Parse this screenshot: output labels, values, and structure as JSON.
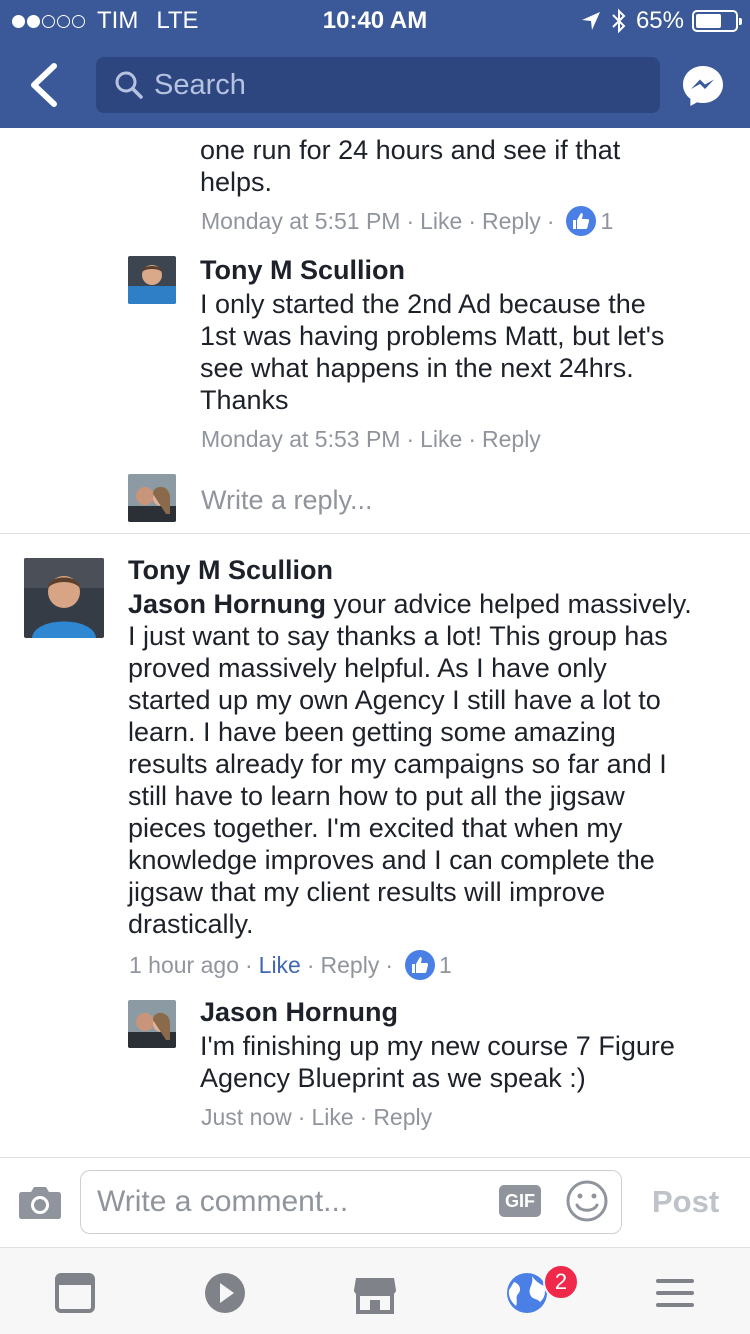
{
  "status_bar": {
    "carrier": "TIM",
    "network": "LTE",
    "time": "10:40 AM",
    "battery": "65%",
    "battery_level": 0.65,
    "signal_bars": 2
  },
  "header": {
    "search_placeholder": "Search"
  },
  "thread": {
    "prev_comment": {
      "line1": "one run for 24 hours and see if that",
      "line2": "helps.",
      "time": "Monday at 5:51 PM",
      "like": "Like",
      "reply": "Reply",
      "likes": "1"
    },
    "reply1": {
      "author": "Tony M Scullion",
      "lines": [
        "I only started the 2nd Ad because the",
        "1st was having problems Matt, but let's",
        "see what happens in the next 24hrs.",
        "Thanks"
      ],
      "time": "Monday at 5:53 PM",
      "like": "Like",
      "reply": "Reply"
    },
    "write_reply_placeholder": "Write a reply..."
  },
  "comment": {
    "author": "Tony M Scullion",
    "mention": "Jason Hornung",
    "first_line_rest": " your advice helped massively.",
    "lines": [
      "I just want to say thanks a lot! This group has",
      "proved massively helpful. As I have only",
      "started up my own Agency I still have a lot to",
      "learn. I have been getting some amazing",
      "results already for my campaigns so far and I",
      "still have to learn how to put all the jigsaw",
      "pieces together. I'm excited that when my",
      "knowledge improves and I can complete the",
      "jigsaw that my client results will improve",
      "drastically."
    ],
    "time": "1 hour ago",
    "like": "Like",
    "reply": "Reply",
    "likes": "1"
  },
  "reply2": {
    "author": "Jason Hornung",
    "lines": [
      "I'm finishing up my new course 7 Figure",
      "Agency Blueprint as we speak :)"
    ],
    "time": "Just now",
    "like": "Like",
    "reply": "Reply"
  },
  "composer": {
    "placeholder": "Write a comment...",
    "gif": "GIF",
    "post": "Post"
  },
  "tabbar": {
    "notifications_badge": "2",
    "icons": [
      "news-feed-icon",
      "video-icon",
      "marketplace-icon",
      "notifications-globe-icon",
      "menu-icon"
    ]
  },
  "colors": {
    "brand": "#3b5998",
    "like_blue": "#4267b2",
    "badge_red": "#f02849"
  }
}
